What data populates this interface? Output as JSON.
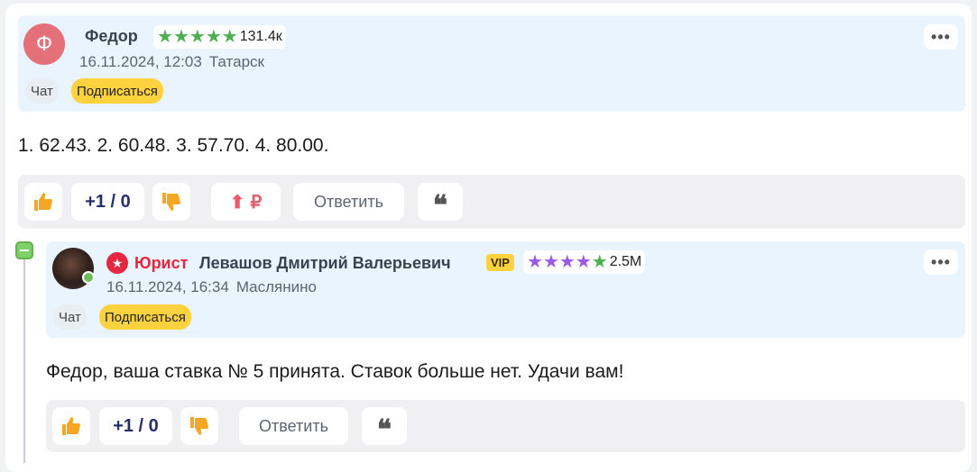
{
  "comment1": {
    "avatar_letter": "Ф",
    "author": "Федор",
    "rating": "131.4к",
    "stars_color": "#4caf50",
    "date": "16.11.2024, 12:03",
    "location": "Татарск",
    "chat_label": "Чат",
    "subscribe_label": "Подписаться",
    "menu_label": "•••",
    "text": "1. 62.43. 2. 60.48. 3. 57.70. 4. 80.00.",
    "score": "+1 / 0",
    "reply_label": "Ответить",
    "quote_label": "❝"
  },
  "comment2": {
    "role": "Юрист",
    "author": "Левашов Дмитрий Валерьевич",
    "vip_label": "VIP",
    "rating": "2.5M",
    "date": "16.11.2024, 16:34",
    "location": "Маслянино",
    "chat_label": "Чат",
    "subscribe_label": "Подписаться",
    "menu_label": "•••",
    "text": "Федор, ваша ставка № 5 принята. Ставок больше нет. Удачи вам!",
    "score": "+1 / 0",
    "reply_label": "Ответить",
    "quote_label": "❝"
  },
  "colors": {
    "header_bg": "#e9f4fe",
    "accent_yellow": "#fdd23f",
    "thumb_orange": "#f5a623",
    "score_navy": "#27306a",
    "role_red": "#e5263f",
    "stars_purple": "#9b59e6",
    "stars_green": "#4caf50"
  }
}
